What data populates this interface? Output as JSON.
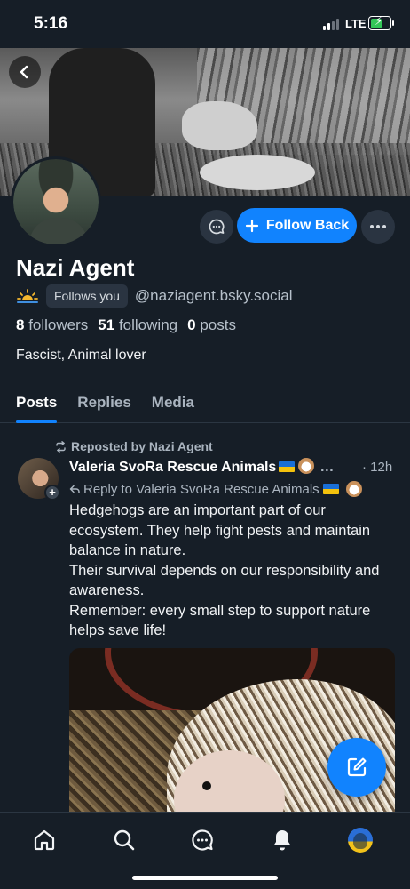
{
  "status_bar": {
    "time": "5:16",
    "network": "LTE"
  },
  "profile": {
    "display_name": "Nazi Agent",
    "follows_you": "Follows you",
    "handle": "@naziagent.bsky.social",
    "followers_count": "8",
    "followers_label": "followers",
    "following_count": "51",
    "following_label": "following",
    "posts_count": "0",
    "posts_label": "posts",
    "bio": "Fascist, Animal lover",
    "follow_back_label": "Follow Back"
  },
  "tabs": [
    {
      "label": "Posts",
      "active": true
    },
    {
      "label": "Replies",
      "active": false
    },
    {
      "label": "Media",
      "active": false
    }
  ],
  "post": {
    "repost_label": "Reposted by Nazi Agent",
    "author": "Valeria SvoRa Rescue Animals",
    "time": "· 12h",
    "reply_to": "Reply to Valeria SvoRa Rescue Animals",
    "body": [
      "Hedgehogs are an important part of our ecosystem. They help fight pests and maintain balance in nature.",
      "Their survival depends on our responsibility and awareness.",
      "Remember: every small step to support nature helps save life!"
    ]
  },
  "colors": {
    "accent": "#1183fe",
    "background": "#161e27",
    "muted": "#aab4bf"
  },
  "icons": [
    "back-arrow-icon",
    "message-icon",
    "plus-icon",
    "more-icon",
    "repost-icon",
    "reply-icon",
    "compose-icon",
    "home-icon",
    "search-icon",
    "chat-icon",
    "bell-icon"
  ]
}
